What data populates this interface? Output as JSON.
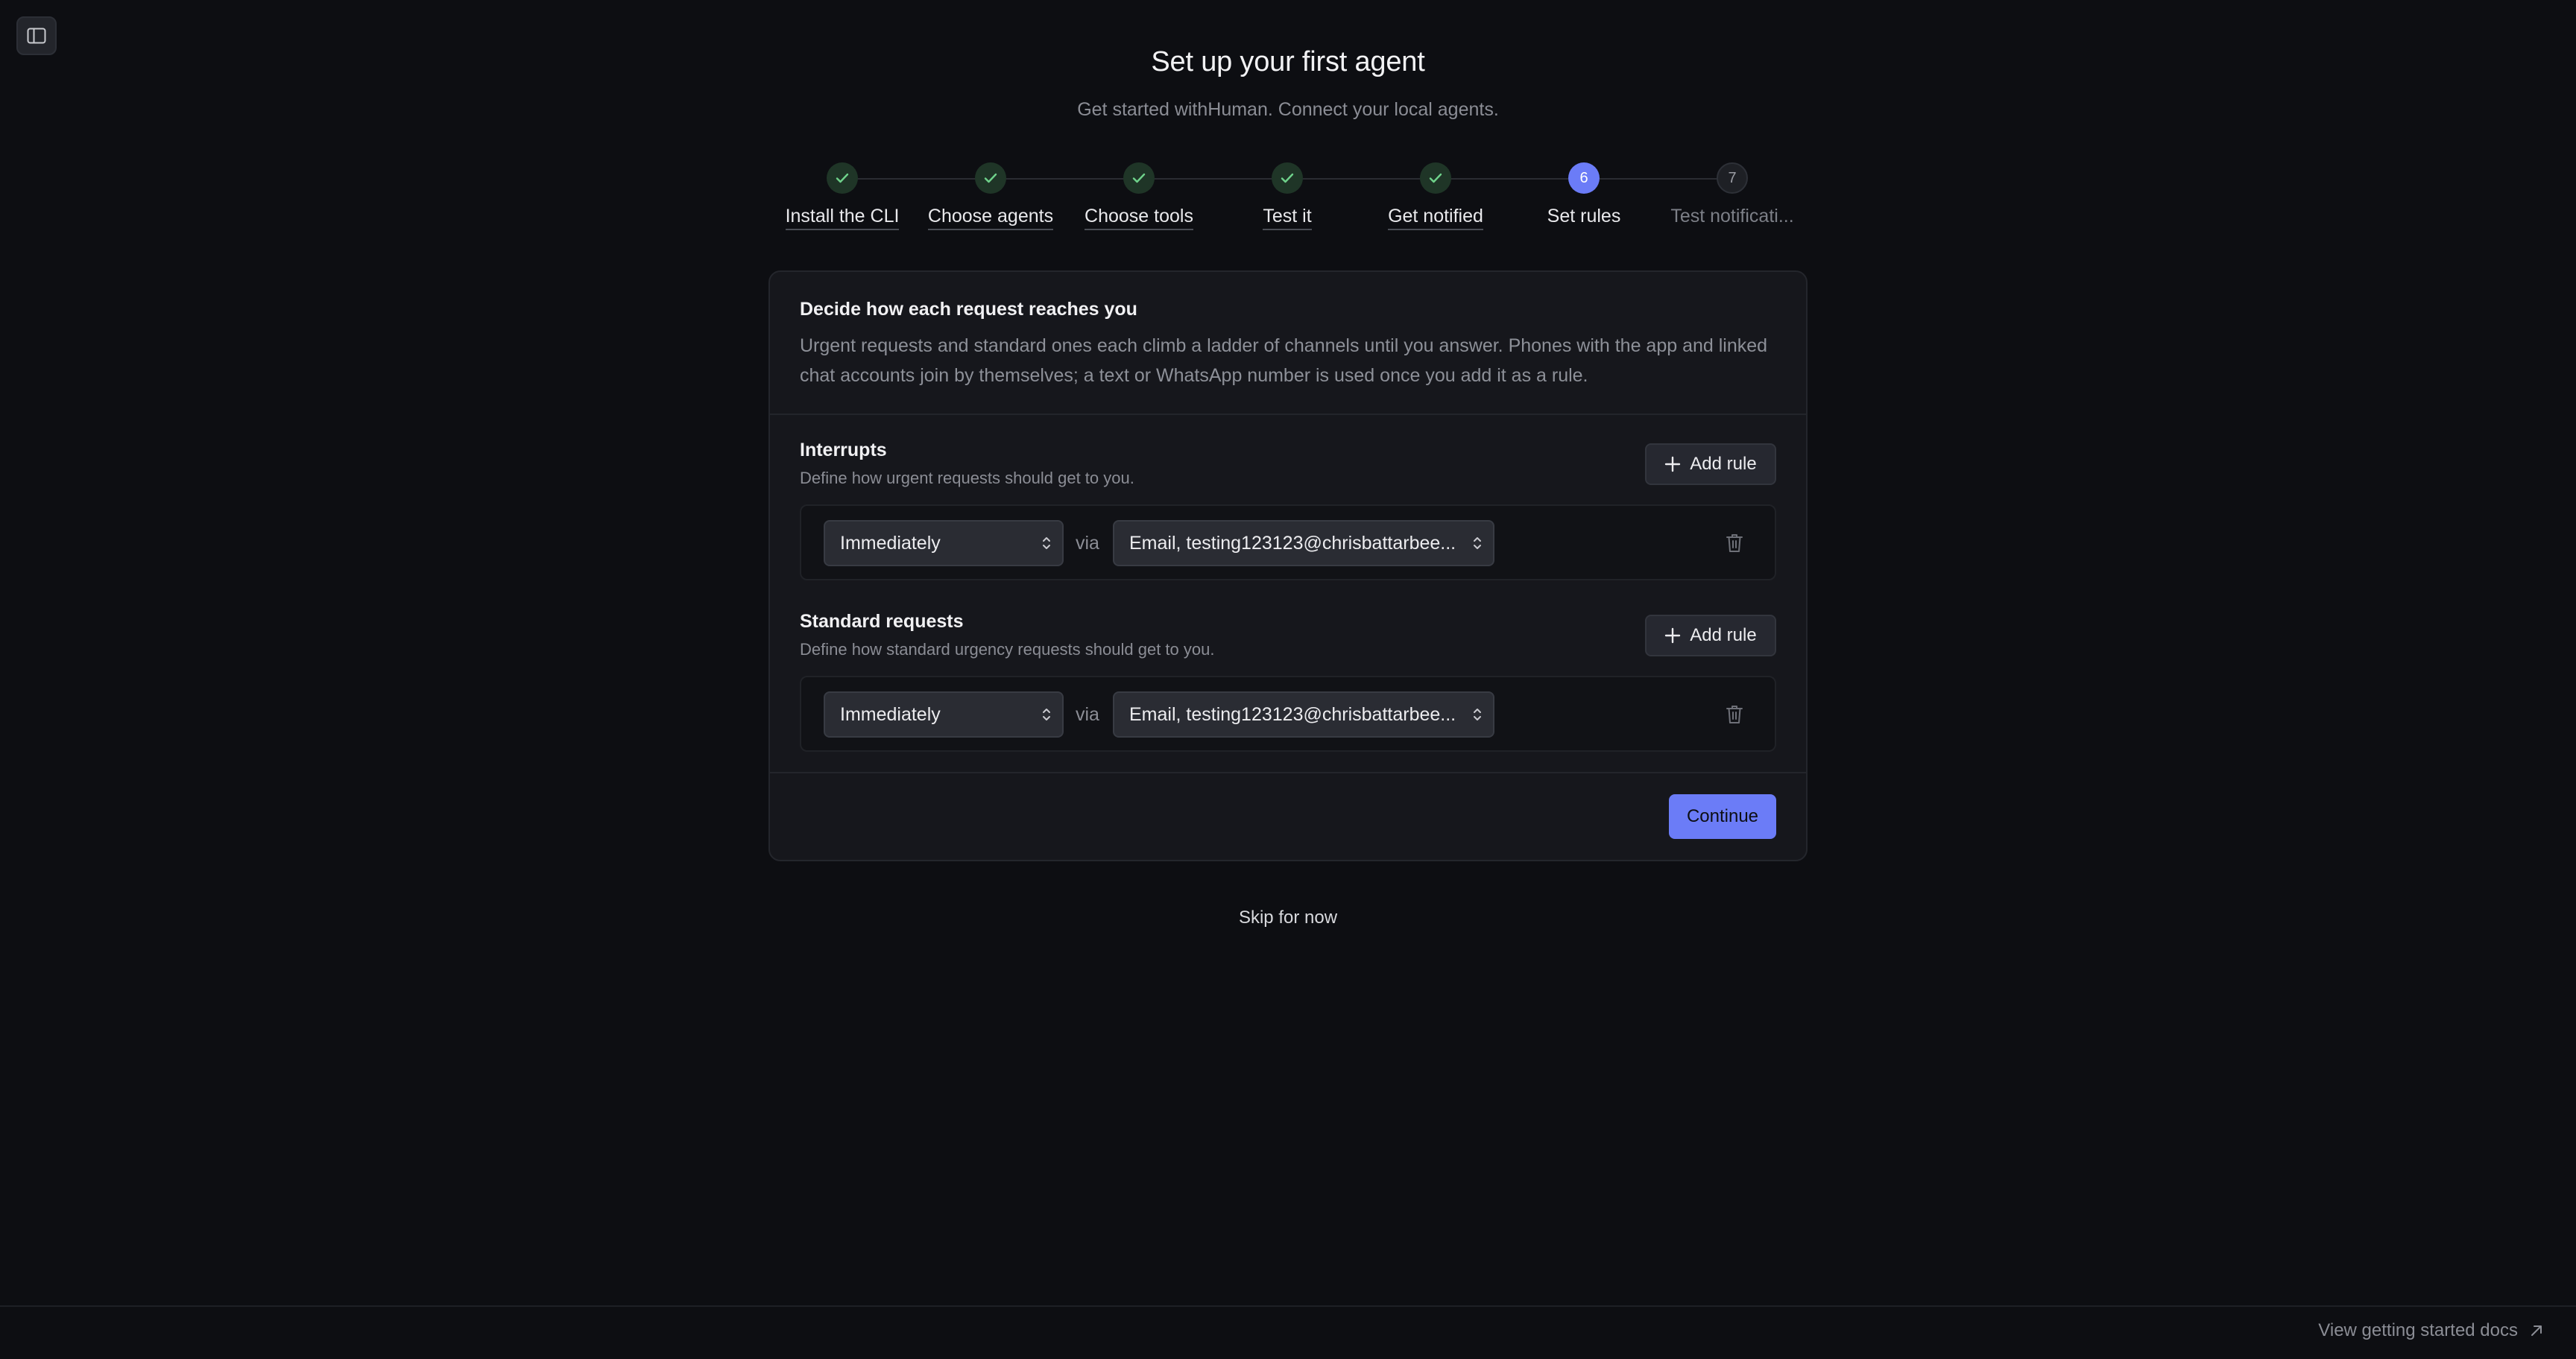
{
  "header": {
    "title": "Set up your first agent",
    "subtitle": "Get started withHuman. Connect your local agents."
  },
  "stepper": {
    "steps": [
      {
        "label": "Install the CLI",
        "status": "done"
      },
      {
        "label": "Choose agents",
        "status": "done"
      },
      {
        "label": "Choose tools",
        "status": "done"
      },
      {
        "label": "Test it",
        "status": "done"
      },
      {
        "label": "Get notified",
        "status": "done"
      },
      {
        "label": "Set rules",
        "status": "active",
        "number": "6"
      },
      {
        "label": "Test notificati...",
        "status": "todo",
        "number": "7"
      }
    ]
  },
  "card": {
    "intro_title": "Decide how each request reaches you",
    "intro_desc": "Urgent requests and standard ones each climb a ladder of channels until you answer. Phones with the app and linked chat accounts join by themselves; a text or WhatsApp number is used once you add it as a rule.",
    "interrupts": {
      "title": "Interrupts",
      "desc": "Define how urgent requests should get to you.",
      "add_label": "Add rule",
      "rule": {
        "timing": "Immediately",
        "via": "via",
        "channel": "Email, testing123123@chrisbattarbee..."
      }
    },
    "standard": {
      "title": "Standard requests",
      "desc": "Define how standard urgency requests should get to you.",
      "add_label": "Add rule",
      "rule": {
        "timing": "Immediately",
        "via": "via",
        "channel": "Email, testing123123@chrisbattarbee..."
      }
    },
    "continue_label": "Continue"
  },
  "skip_label": "Skip for now",
  "footer": {
    "docs_label": "View getting started docs"
  },
  "colors": {
    "background": "#0d0e12",
    "accent": "#6b7cf7",
    "success": "#6fd28b"
  }
}
